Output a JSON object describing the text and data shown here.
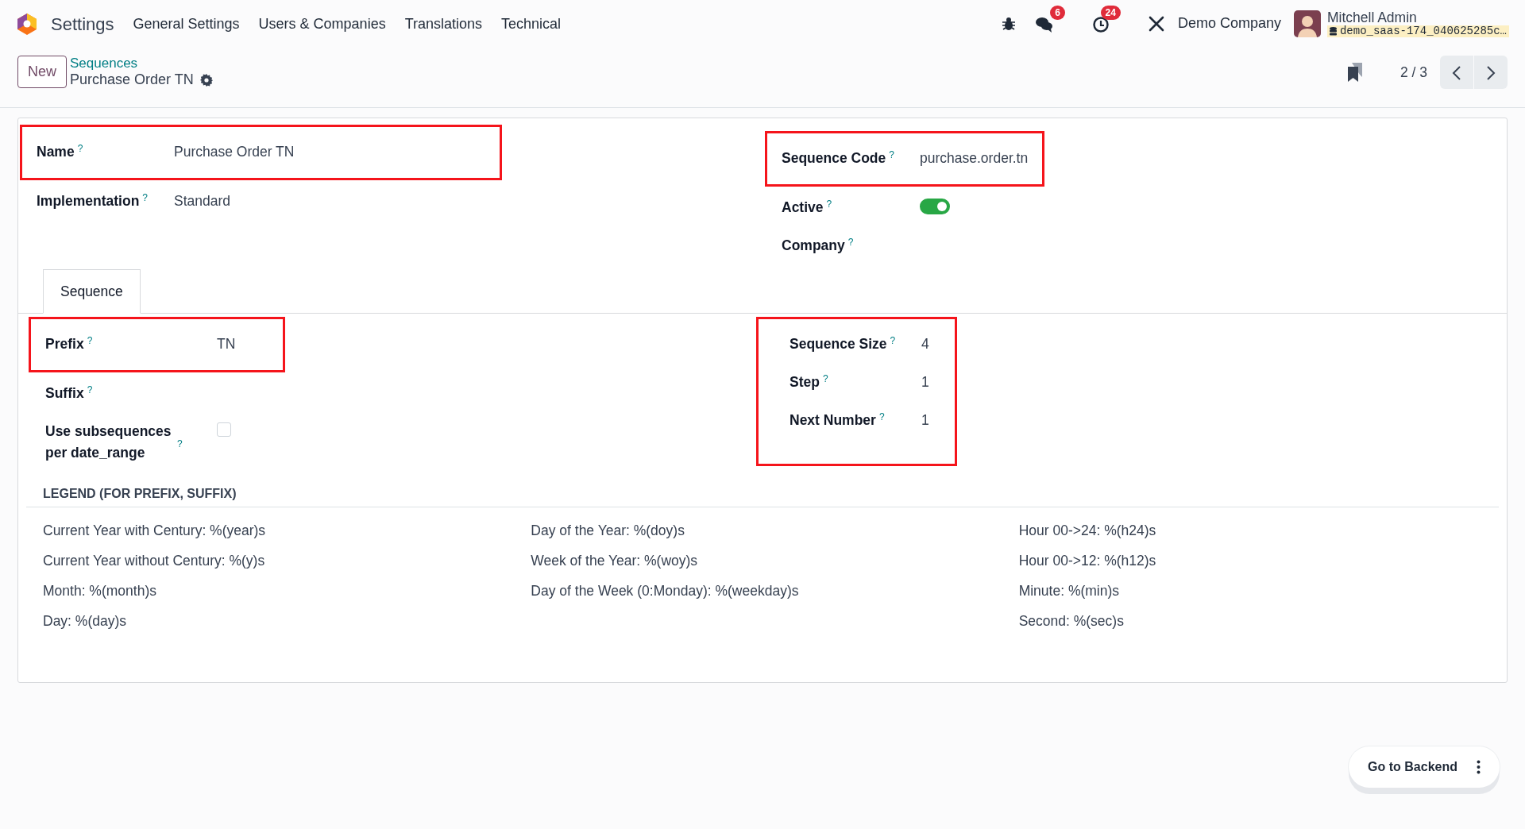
{
  "navbar": {
    "app": "Settings",
    "menu": [
      "General Settings",
      "Users & Companies",
      "Translations",
      "Technical"
    ],
    "messages_badge": "6",
    "activities_badge": "24",
    "company": "Demo Company",
    "user": "Mitchell Admin",
    "database": "demo_saas-174_040625285c…"
  },
  "control_panel": {
    "new_button": "New",
    "breadcrumb": "Sequences",
    "record_title": "Purchase Order TN",
    "pager": "2 / 3"
  },
  "form": {
    "left_groups": [
      {
        "highlighted": true,
        "fields": [
          {
            "kind": "text",
            "label": "Name",
            "help": "?",
            "value": "Purchase Order TN"
          }
        ]
      },
      {
        "highlighted": false,
        "fields": [
          {
            "kind": "text",
            "label": "Implementation",
            "help": "?",
            "value": "Standard"
          }
        ]
      }
    ],
    "right_groups": [
      {
        "highlighted": true,
        "fields": [
          {
            "kind": "text",
            "label": "Sequence Code",
            "help": "?",
            "value": "purchase.order.tn"
          }
        ]
      },
      {
        "highlighted": false,
        "fields": [
          {
            "kind": "toggle",
            "label": "Active",
            "help": "?",
            "on": true
          },
          {
            "kind": "text",
            "label": "Company",
            "help": "?"
          }
        ]
      }
    ]
  },
  "tabs": [
    {
      "label": "Sequence",
      "selected": true
    }
  ],
  "notebook": {
    "left_groups": [
      {
        "highlighted": true,
        "fields": [
          {
            "kind": "text",
            "label": "Prefix",
            "help": "?",
            "value": "TN"
          }
        ]
      },
      {
        "highlighted": false,
        "fields": [
          {
            "kind": "text",
            "label": "Suffix",
            "help": "?"
          },
          {
            "kind": "checkbox",
            "label": "Use subsequences per date_range",
            "help": "?",
            "checked": false
          }
        ]
      }
    ],
    "right_groups": [
      {
        "highlighted": true,
        "fields": [
          {
            "kind": "text",
            "label": "Sequence Size",
            "help": "?",
            "value": "4"
          },
          {
            "kind": "text",
            "label": "Step",
            "help": "?",
            "value": "1"
          },
          {
            "kind": "text",
            "label": "Next Number",
            "help": "?",
            "value": "1"
          }
        ]
      }
    ]
  },
  "legend": {
    "title": "LEGEND (FOR PREFIX, SUFFIX)",
    "columns": [
      [
        "Current Year with Century: %(year)s",
        "Current Year without Century: %(y)s",
        "Month: %(month)s",
        "Day: %(day)s"
      ],
      [
        "Day of the Year: %(doy)s",
        "Week of the Year: %(woy)s",
        "Day of the Week (0:Monday): %(weekday)s"
      ],
      [
        "Hour 00->24: %(h24)s",
        "Hour 00->12: %(h12)s",
        "Minute: %(min)s",
        "Second: %(sec)s"
      ]
    ]
  },
  "floating_button": {
    "label": "Go to Backend"
  }
}
